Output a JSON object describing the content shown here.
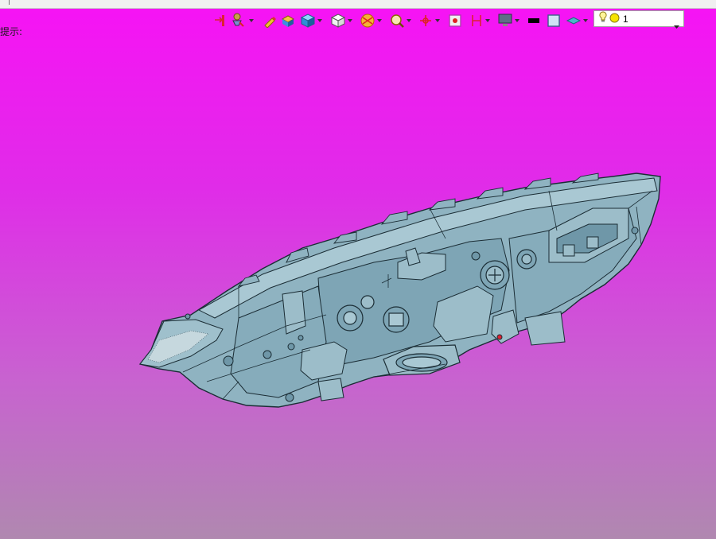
{
  "hint": {
    "label": "提示:"
  },
  "toolbar": {
    "icons": [
      "extract-icon",
      "select-filter-icon",
      "highlighter-icon",
      "display-style-icon",
      "render-mode-icon",
      "view-orientation-icon",
      "section-icon",
      "zoom-icon",
      "pan-icon",
      "fit-icon",
      "clip-icon",
      "monitor-icon",
      "black-color-icon",
      "background-color-icon",
      "layer-icon"
    ]
  },
  "layer_select": {
    "value": "1"
  },
  "colors": {
    "bg_top": "#f712f5",
    "bg_bottom": "#b088b0",
    "model_fill": "#8fb3c1",
    "model_dark": "#6f97a8",
    "model_edge": "#1b2d35"
  }
}
